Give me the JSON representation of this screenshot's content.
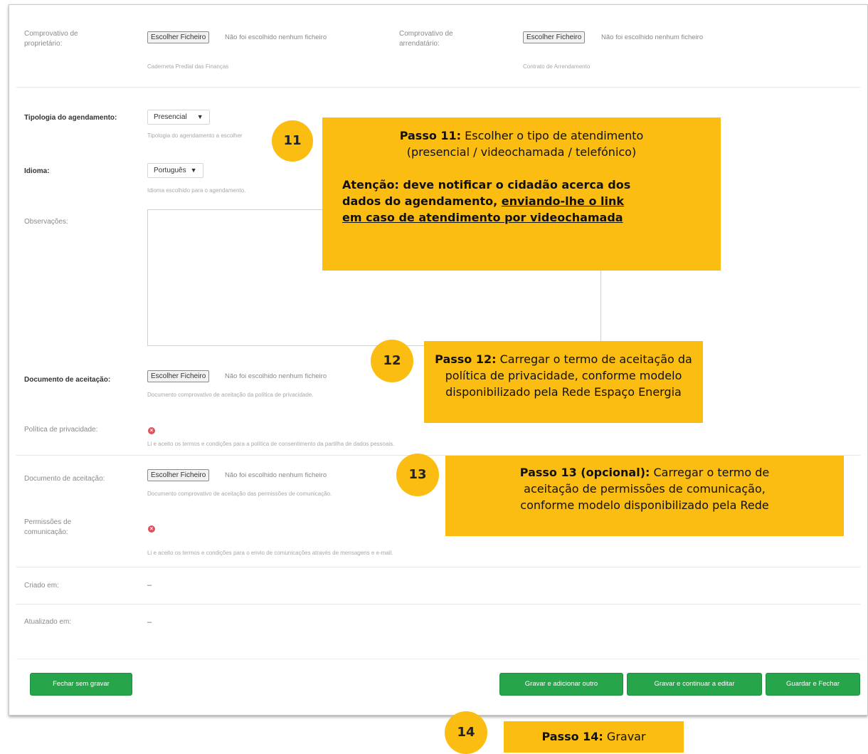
{
  "form": {
    "comprovativo_proprietario": {
      "label": "Comprovativo de proprietário:",
      "button": "Escolher Ficheiro",
      "status": "Não foi escolhido nenhum ficheiro",
      "help": "Caderneta Predial das Finanças"
    },
    "comprovativo_arrendatario": {
      "label": "Comprovativo de arrendatário:",
      "button": "Escolher Ficheiro",
      "status": "Não foi escolhido nenhum ficheiro",
      "help": "Contrato de Arrendamento"
    },
    "tipologia": {
      "label": "Tipologia do agendamento:",
      "value": "Presencial",
      "help": "Tipologia do agendamento a escolher"
    },
    "idioma": {
      "label": "Idioma:",
      "value": "Português",
      "help": "Idioma escolhido para o agendamento."
    },
    "observacoes": {
      "label": "Observações:"
    },
    "documento_aceitacao_1": {
      "label": "Documento de aceitação:",
      "button": "Escolher Ficheiro",
      "status": "Não foi escolhido nenhum ficheiro",
      "help": "Documento comprovativo de aceitação da política de privacidade."
    },
    "politica_privacidade": {
      "label": "Política de privacidade:",
      "help": "Li e aceito os termos e condições para a política de consentimento da partilha de dados pessoais."
    },
    "documento_aceitacao_2": {
      "label": "Documento de aceitação:",
      "button": "Escolher Ficheiro",
      "status": "Não foi escolhido nenhum ficheiro",
      "help": "Documento comprovativo de aceitação das permissões de comunicação."
    },
    "permissoes_comunicacao": {
      "label": "Permissões de comunicação:",
      "help": "Li e aceito os termos e condições para o envio de comunicações através de mensagens e e-mail."
    },
    "criado_em": {
      "label": "Criado em:",
      "value": "–"
    },
    "atualizado_em": {
      "label": "Atualizado em:",
      "value": "–"
    }
  },
  "buttons": {
    "fechar_sem_gravar": "Fechar sem gravar",
    "gravar_adicionar": "Gravar e adicionar outro",
    "gravar_continuar": "Gravar e continuar a editar",
    "guardar_fechar": "Guardar e Fechar"
  },
  "callouts": {
    "c11": {
      "badge": "11",
      "title": "Passo 11:",
      "line1": " Escolher o tipo de atendimento",
      "line2": "(presencial / videochamada / telefónico)",
      "warn1": "Atenção: deve notificar o cidadão acerca dos",
      "warn2": "dados do agendamento, ",
      "warn2_u": "enviando-lhe o link",
      "warn3_u": "em caso de atendimento por videochamada"
    },
    "c12": {
      "badge": "12",
      "title": "Passo 12:",
      "line1": " Carregar o termo de aceitação da",
      "line2": "política de privacidade, conforme modelo",
      "line3": "disponibilizado pela Rede Espaço Energia"
    },
    "c13": {
      "badge": "13",
      "title": "Passo 13 (opcional):",
      "line1": " Carregar o termo de",
      "line2": "aceitação de permissões de comunicação,",
      "line3": "conforme modelo disponibilizado pela Rede"
    },
    "c14": {
      "badge": "14",
      "title": "Passo 14:",
      "line1": " Gravar"
    }
  },
  "colors": {
    "accent_green": "#27a54a",
    "callout_yellow": "#fbbd12",
    "check_red": "#e0525a"
  }
}
